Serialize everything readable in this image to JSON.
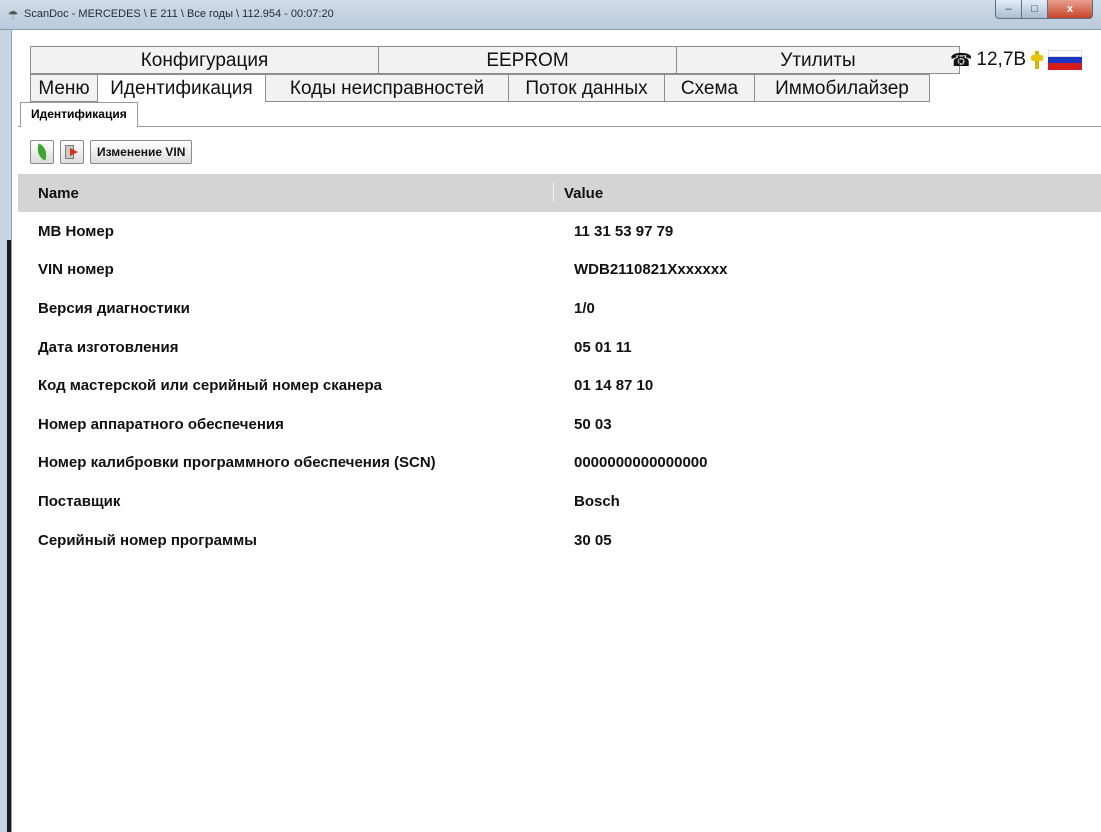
{
  "window": {
    "title": "ScanDoc - MERCEDES \\ E 211 \\ Все годы \\ 112.954 - 00:07:20",
    "min": "–",
    "max": "□",
    "close": "x"
  },
  "tabs_top": [
    {
      "label": "Конфигурация"
    },
    {
      "label": "EEPROM"
    },
    {
      "label": "Утилиты"
    }
  ],
  "tabs_bottom": [
    {
      "label": "Меню"
    },
    {
      "label": "Идентификация",
      "active": true
    },
    {
      "label": "Коды неисправностей"
    },
    {
      "label": "Поток данных"
    },
    {
      "label": "Схема"
    },
    {
      "label": "Иммобилайзер"
    }
  ],
  "status": {
    "voltage": "12,7В",
    "icons": [
      "phone-icon",
      "plug-icon",
      "flag-icon"
    ]
  },
  "subtab": {
    "label": "Идентификация"
  },
  "toolbar": {
    "change_vin_label": "Изменение VIN",
    "icons": [
      "leaf-icon",
      "exit-icon"
    ]
  },
  "table": {
    "headers": {
      "name": "Name",
      "value": "Value"
    },
    "rows": [
      {
        "name": "MB Номер",
        "value": "11 31 53 97 79"
      },
      {
        "name": "VIN номер",
        "value": "WDB2110821Xxxxxxx"
      },
      {
        "name": "Версия диагностики",
        "value": "1/0"
      },
      {
        "name": "Дата изготовления",
        "value": "05 01 11"
      },
      {
        "name": "Код мастерской или серийный номер сканера",
        "value": "01 14 87 10"
      },
      {
        "name": "Номер аппаратного обеспечения",
        "value": "50 03"
      },
      {
        "name": "Номер калибровки программного обеспечения (SCN)",
        "value": "0000000000000000"
      },
      {
        "name": "Поставщик",
        "value": "Bosch"
      },
      {
        "name": "Серийный номер программы",
        "value": "30 05"
      }
    ]
  },
  "colors": {
    "header_bg": "#d4d4d4",
    "close_btn": "#c7442a",
    "flag_blue": "#1b35c4",
    "flag_red": "#d51c1c"
  }
}
